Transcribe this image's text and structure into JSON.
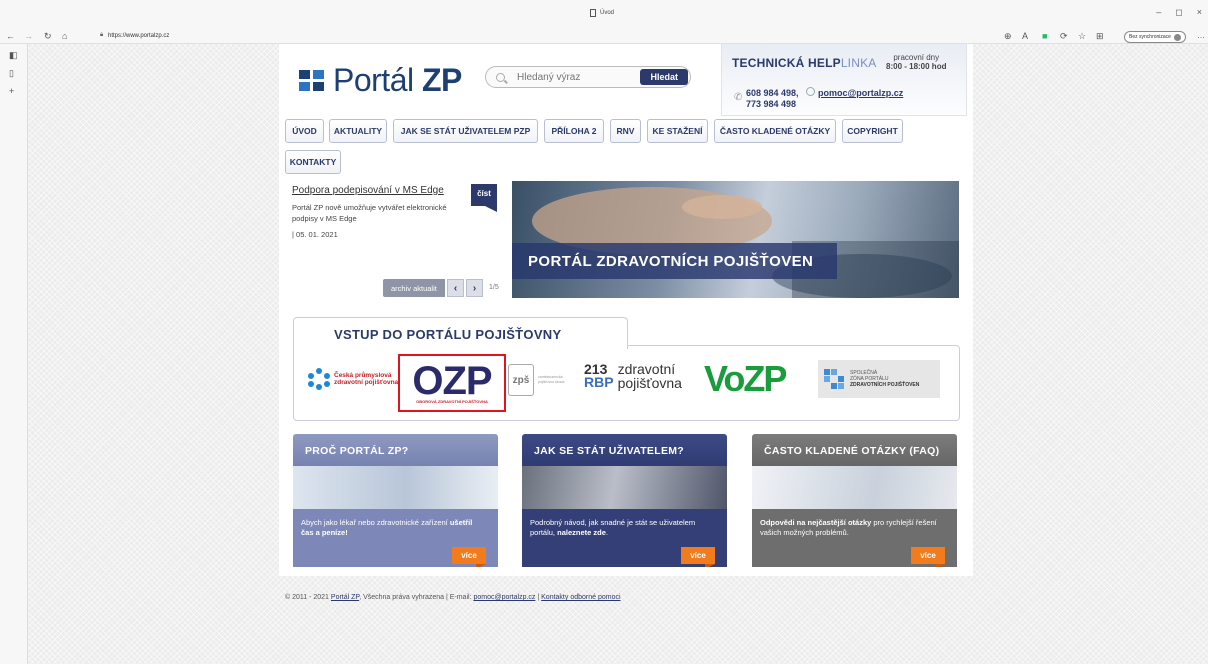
{
  "browser": {
    "tab_title": "Úvod",
    "url": "https://www.portalzp.cz",
    "sync_label": "Bez synchronizace"
  },
  "header": {
    "logo_regular": "Portál ",
    "logo_bold": "ZP",
    "search_placeholder": "Hledaný výraz",
    "search_button": "Hledat"
  },
  "helpline": {
    "title_bold": "TECHNICKÁ HELP",
    "title_light": "LINKA",
    "hours_label": "pracovní dny",
    "hours": "8:00 - 18:00 hod",
    "phone1": "608 984 498,",
    "phone2": "773 984 498",
    "email": "pomoc@portalzp.cz"
  },
  "nav": {
    "items": [
      "ÚVOD",
      "AKTUALITY",
      "JAK SE STÁT UŽIVATELEM PZP",
      "PŘÍLOHA 2",
      "RNV",
      "KE STAŽENÍ",
      "ČASTO KLADENÉ OTÁZKY",
      "COPYRIGHT",
      "KONTAKTY"
    ]
  },
  "news": {
    "title": "Podpora podepisování v MS Edge",
    "text": "Portál ZP nově umožňuje vytvářet elektronické podpisy v MS Edge",
    "date": "| 05. 01. 2021",
    "read_label": "číst",
    "archive_label": "archiv aktualit",
    "pager": "1/5"
  },
  "banner": {
    "text": "PORTÁL ZDRAVOTNÍCH POJIŠŤOVEN"
  },
  "insurers": {
    "title": "VSTUP DO PORTÁLU POJIŠŤOVNY",
    "cpzp_line1": "Česká průmyslová",
    "cpzp_line2": "zdravotní pojišťovna",
    "ozp_name": "OZP",
    "ozp_sub": "OBOROVÁ ZDRAVOTNÍ POJIŠŤOVNA",
    "zps_mark": "zpš",
    "zps_sub": "zaměstnanecká pojišťovna škoda",
    "rbp_num1": "213",
    "rbp_num2": "RBP",
    "rbp_line1": "zdravotní",
    "rbp_line2": "pojišťovna",
    "vozp_name": "VoZP",
    "szp_line1": "SPOLEČNÁ",
    "szp_line2": "ZÓNA PORTÁLU",
    "szp_line3": "ZDRAVOTNÍCH POJIŠŤOVEN"
  },
  "cards": {
    "why": {
      "title": "PROČ PORTÁL ZP?",
      "text": "Abych jako lékař nebo zdravotnické zařízení ",
      "bold": "ušetřil čas a peníze!",
      "more": "více"
    },
    "user": {
      "title": "JAK SE STÁT UŽIVATELEM?",
      "text": "Podrobný návod, jak snadné je stát se uživatelem portálu, ",
      "bold": "naleznete zde",
      "tail": ".",
      "more": "více"
    },
    "faq": {
      "title": "ČASTO KLADENÉ OTÁZKY (FAQ)",
      "bold": "Odpovědi na nejčastější otázky",
      "text": " pro rychlejší řešení vašich možných problémů.",
      "more": "více"
    }
  },
  "footer": {
    "copyright": "© 2011 - 2021 ",
    "brand_link": "Portál ZP",
    "rights": ", Všechna práva vyhrazena  |  E-mail: ",
    "email": "pomoc@portalzp.cz",
    "sep": "  |  ",
    "contacts_link": "Kontakty odborné pomoci"
  }
}
